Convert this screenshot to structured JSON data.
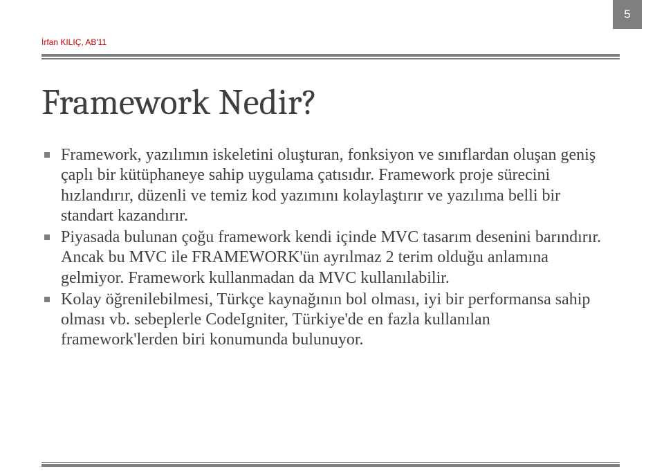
{
  "page_number": "5",
  "author": "İrfan KILIÇ, AB'11",
  "title": "Framework Nedir?",
  "bullets": [
    "Framework, yazılımın iskeletini oluşturan, fonksiyon ve sınıflardan oluşan geniş çaplı bir kütüphaneye sahip uygulama çatısıdır. Framework proje sürecini hızlandırır, düzenli ve temiz kod yazımını kolaylaştırır ve yazılıma belli bir standart kazandırır.",
    "Piyasada bulunan çoğu framework kendi içinde MVC tasarım desenini barındırır. Ancak bu MVC ile FRAMEWORK'ün ayrılmaz 2 terim olduğu anlamına gelmiyor. Framework kullanmadan da MVC kullanılabilir.",
    "Kolay öğrenilebilmesi, Türkçe kaynağının bol olması, iyi bir performansa sahip olması vb. sebeplerle CodeIgniter, Türkiye'de en fazla kullanılan framework'lerden biri konumunda bulunuyor."
  ]
}
